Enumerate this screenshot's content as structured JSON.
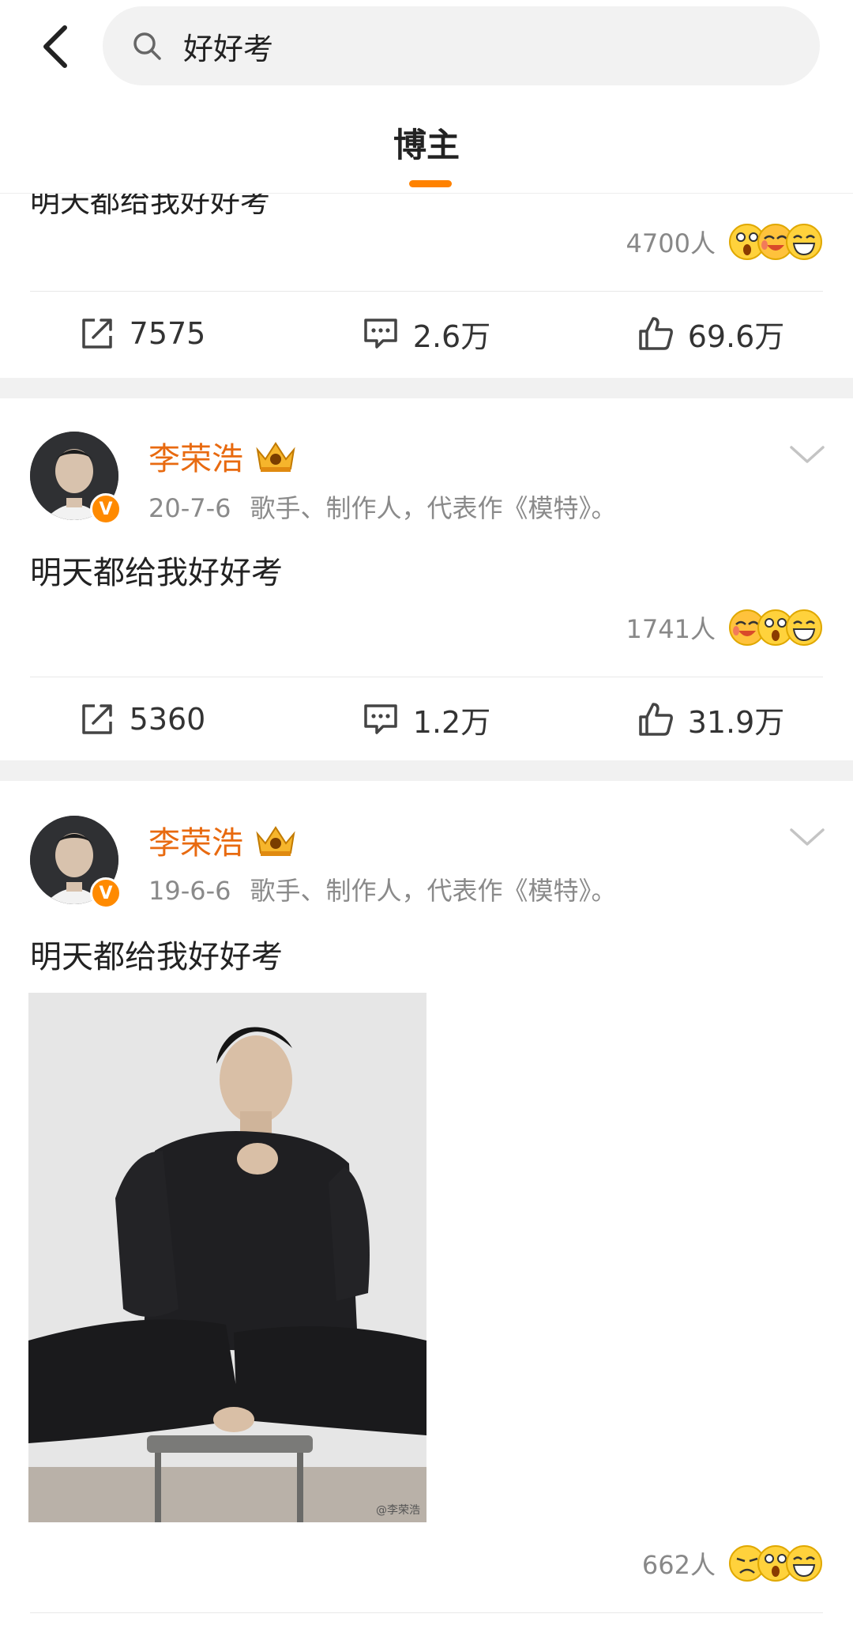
{
  "search": {
    "query": "好好考"
  },
  "tab": {
    "label": "博主"
  },
  "previous_post": {
    "text": "明天都给我好好考",
    "reactions_count": "4700人",
    "actions": {
      "repost": "7575",
      "comment": "2.6万",
      "like": "69.6万"
    }
  },
  "posts": [
    {
      "author": "李荣浩",
      "date": "20-7-6",
      "bio": "歌手、制作人，代表作《模特》。",
      "text": "明天都给我好好考",
      "reactions_count": "1741人",
      "actions": {
        "repost": "5360",
        "comment": "1.2万",
        "like": "31.9万"
      }
    },
    {
      "author": "李荣浩",
      "date": "19-6-6",
      "bio": "歌手、制作人，代表作《模特》。",
      "text": "明天都给我好好考",
      "image_watermark": "@李荣浩",
      "reactions_count": "662人"
    }
  ],
  "badge": {
    "verified": "V"
  },
  "colors": {
    "accent": "#ff8200",
    "author": "#e86a10",
    "gap": "#f1f1f1"
  },
  "icons": [
    "back-icon",
    "search-icon",
    "repost-icon",
    "comment-icon",
    "like-icon",
    "chevron-down-icon",
    "crown-icon",
    "emoji-icon"
  ]
}
